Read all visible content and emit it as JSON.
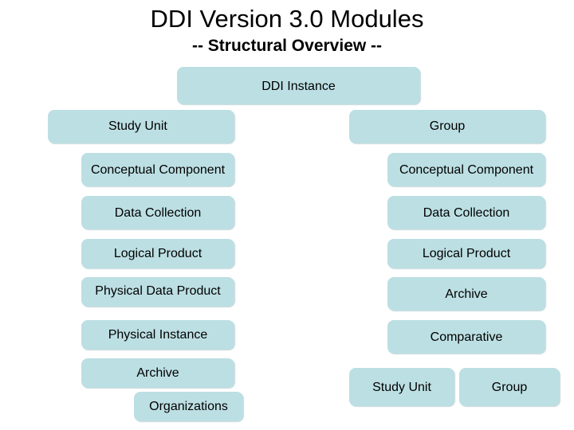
{
  "title": "DDI Version 3.0 Modules",
  "subtitle": "-- Structural Overview --",
  "colors": {
    "box_fill": "#bcdfe3",
    "text": "#000000",
    "background": "#ffffff"
  },
  "root": {
    "label": "DDI Instance"
  },
  "study_unit": {
    "label": "Study Unit",
    "children": [
      "Conceptual Component",
      "Data Collection",
      "Logical Product",
      "Physical Data Product",
      "Physical Instance",
      "Archive"
    ],
    "archive_child": "Organizations"
  },
  "group": {
    "label": "Group",
    "children": [
      "Conceptual Component",
      "Data Collection",
      "Logical Product",
      "Archive",
      "Comparative"
    ],
    "comparative_children": [
      "Study Unit",
      "Group"
    ]
  }
}
